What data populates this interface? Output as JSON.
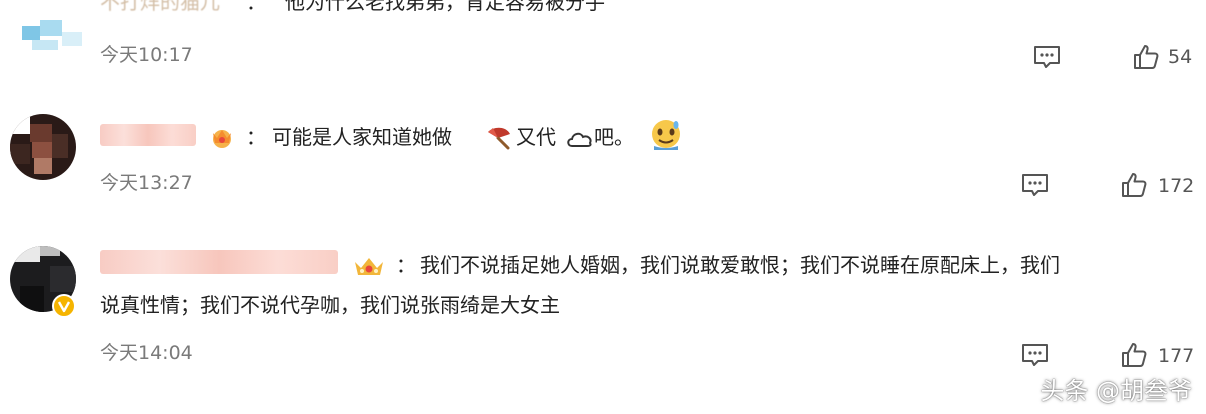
{
  "comments": [
    {
      "name": "不打烊的猫儿",
      "separator": "：",
      "text": "他为什么老找弟弟，肯定容易被分手",
      "time": "今天10:17",
      "likes": "54"
    },
    {
      "name": "",
      "separator": "：",
      "text_a": "可能是人家知道她做",
      "text_b": "又代",
      "text_c": "吧。",
      "time": "今天13:27",
      "likes": "172"
    },
    {
      "name": "",
      "separator": "：",
      "text_line1": "我们不说插足她人婚姻，我们说敢爱敢恨；我们不说睡在原配床上，我们",
      "text_line2": "说真性情；我们不说代孕咖，我们说张雨绮是大女主",
      "time": "今天14:04",
      "likes": "177"
    }
  ],
  "watermark": "头条 @胡叁爷",
  "icons": {
    "reply": "comment-bubble-icon",
    "like": "thumbs-up-icon",
    "badge": "crown-badge-icon"
  },
  "colors": {
    "text": "#222222",
    "meta": "#7a7a7a",
    "badge": "#f5a623"
  }
}
